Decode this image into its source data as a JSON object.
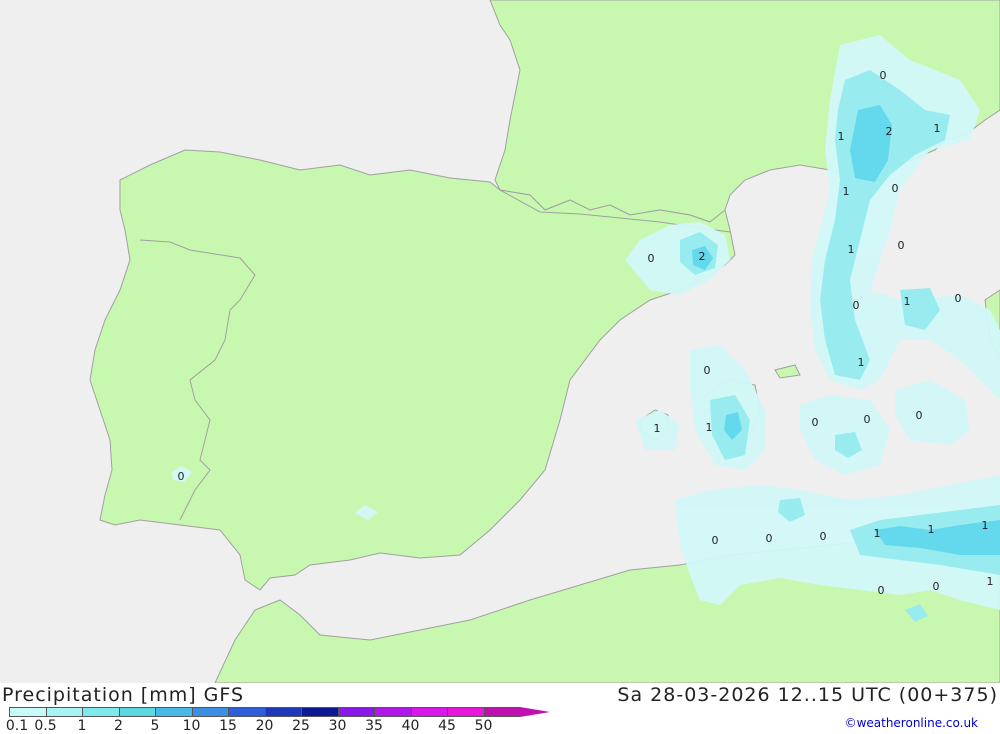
{
  "header": {
    "title": "Precipitation [mm] GFS",
    "date": "Sa 28-03-2026 12..15 UTC (00+375)",
    "credit": "©weatheronline.co.uk"
  },
  "legend": {
    "ticks": [
      "0.1",
      "0.5",
      "1",
      "2",
      "5",
      "10",
      "15",
      "20",
      "25",
      "30",
      "35",
      "40",
      "45",
      "50"
    ],
    "colors": [
      "#c8faf8",
      "#a8f4f4",
      "#7ee8ea",
      "#5dd8e2",
      "#48b8e8",
      "#3c8fe0",
      "#2e5fd8",
      "#1f38b8",
      "#101a90",
      "#8a18e8",
      "#b018e8",
      "#d818e8",
      "#e818d8",
      "#c010b0"
    ]
  },
  "map": {
    "colors": {
      "sea": "#efefef",
      "land": "#c8f8b0",
      "border": "#a0a0a0",
      "light": "#d2f8f8",
      "mid": "#98ecf0",
      "dark": "#64d8ec"
    },
    "contour_labels": [
      {
        "text": "0"
      },
      {
        "text": "2"
      },
      {
        "text": "1"
      },
      {
        "text": "1"
      },
      {
        "text": "1"
      },
      {
        "text": "0"
      },
      {
        "text": "1"
      },
      {
        "text": "0"
      },
      {
        "text": "0"
      },
      {
        "text": "1"
      },
      {
        "text": "0"
      },
      {
        "text": "1"
      },
      {
        "text": "0"
      },
      {
        "text": "2"
      },
      {
        "text": "0"
      },
      {
        "text": "1"
      },
      {
        "text": "1"
      },
      {
        "text": "0"
      },
      {
        "text": "0"
      },
      {
        "text": "0"
      },
      {
        "text": "0"
      },
      {
        "text": "0"
      },
      {
        "text": "0"
      },
      {
        "text": "1"
      },
      {
        "text": "1"
      },
      {
        "text": "1"
      },
      {
        "text": "1"
      },
      {
        "text": "0"
      },
      {
        "text": "0"
      },
      {
        "text": "0"
      }
    ]
  }
}
